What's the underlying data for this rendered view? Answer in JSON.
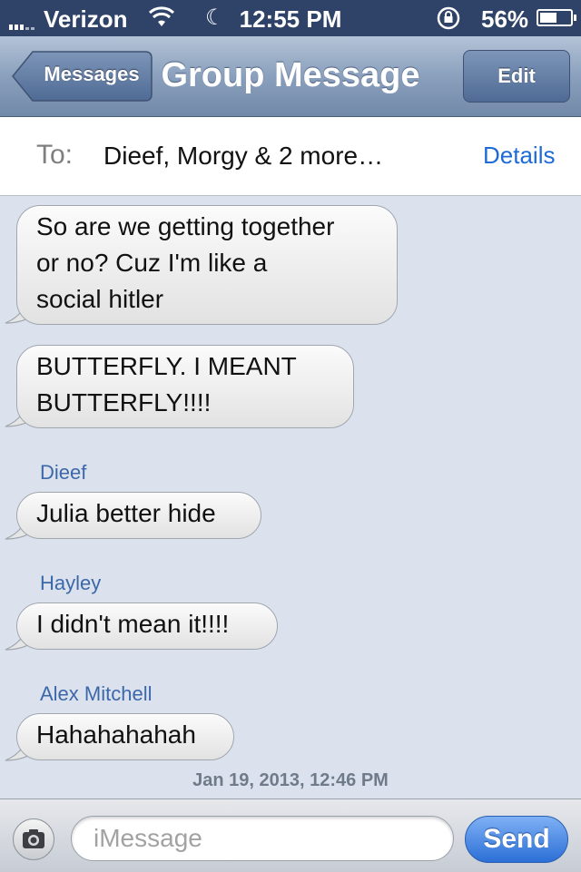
{
  "status_bar": {
    "carrier": "Verizon",
    "time": "12:55 PM",
    "battery_percent": "56%",
    "battery_level": 0.56,
    "icons": [
      "signal-icon",
      "wifi-icon",
      "moon-icon",
      "rotation-lock-icon",
      "battery-icon"
    ]
  },
  "nav": {
    "back_label": "Messages",
    "title": "Group Message",
    "edit_label": "Edit"
  },
  "to_bar": {
    "to_label": "To:",
    "recipients": "Dieef, Morgy & 2 more…",
    "details_label": "Details"
  },
  "messages": [
    {
      "sender": "",
      "lines": [
        "So are we getting together",
        "or no?  Cuz I'm like a",
        "social hitler"
      ]
    },
    {
      "sender": "",
      "lines": [
        "BUTTERFLY. I MEANT",
        "BUTTERFLY!!!!"
      ]
    },
    {
      "sender": "Dieef",
      "lines": [
        "Julia better hide"
      ]
    },
    {
      "sender": "Hayley",
      "lines": [
        "I didn't mean it!!!!"
      ]
    },
    {
      "sender": "Alex Mitchell",
      "lines": [
        "Hahahahahah"
      ]
    }
  ],
  "timestamp": "Jan 19, 2013, 12:46 PM",
  "input_bar": {
    "placeholder": "iMessage",
    "send_label": "Send",
    "camera_icon": "camera-icon"
  },
  "colors": {
    "background": "#dbe2ed",
    "status_bar": "#2f4368",
    "link_blue": "#1e6ad6",
    "sender_blue": "#3c68aa"
  }
}
